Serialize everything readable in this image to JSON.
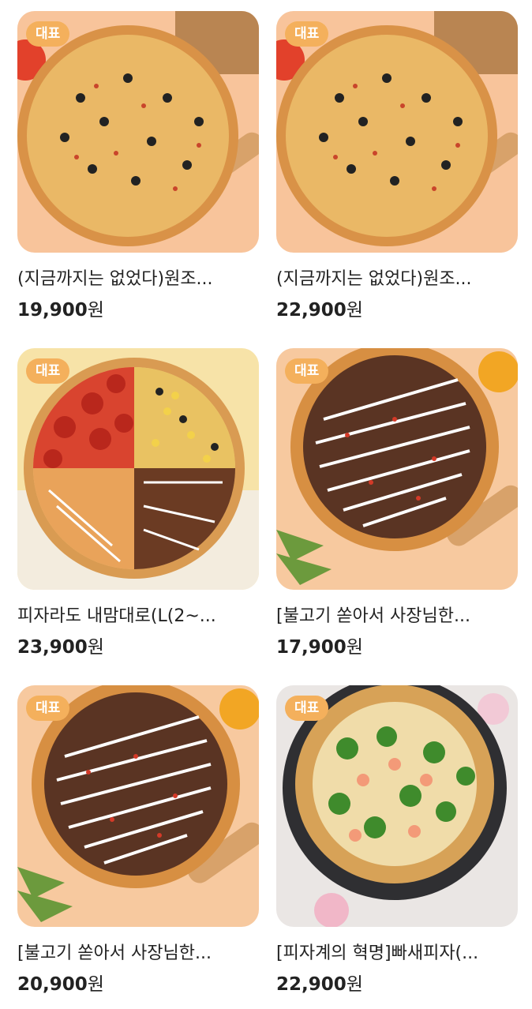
{
  "products": [
    {
      "badge": "대표",
      "title": "(지금까지는 없었다)원조...",
      "price": "19,900",
      "currency": "원"
    },
    {
      "badge": "대표",
      "title": "(지금까지는 없었다)원조...",
      "price": "22,900",
      "currency": "원"
    },
    {
      "badge": "대표",
      "title": "피자라도 내맘대로(L(2~...",
      "price": "23,900",
      "currency": "원"
    },
    {
      "badge": "대표",
      "title": "[불고기 쏟아서 사장님한...",
      "price": "17,900",
      "currency": "원"
    },
    {
      "badge": "대표",
      "title": "[불고기 쏟아서 사장님한...",
      "price": "20,900",
      "currency": "원"
    },
    {
      "badge": "대표",
      "title": "[피자계의 혁명]빠새피자(...",
      "price": "22,900",
      "currency": "원"
    }
  ],
  "colors": {
    "badge": "#f4b05c",
    "text": "#222222"
  }
}
